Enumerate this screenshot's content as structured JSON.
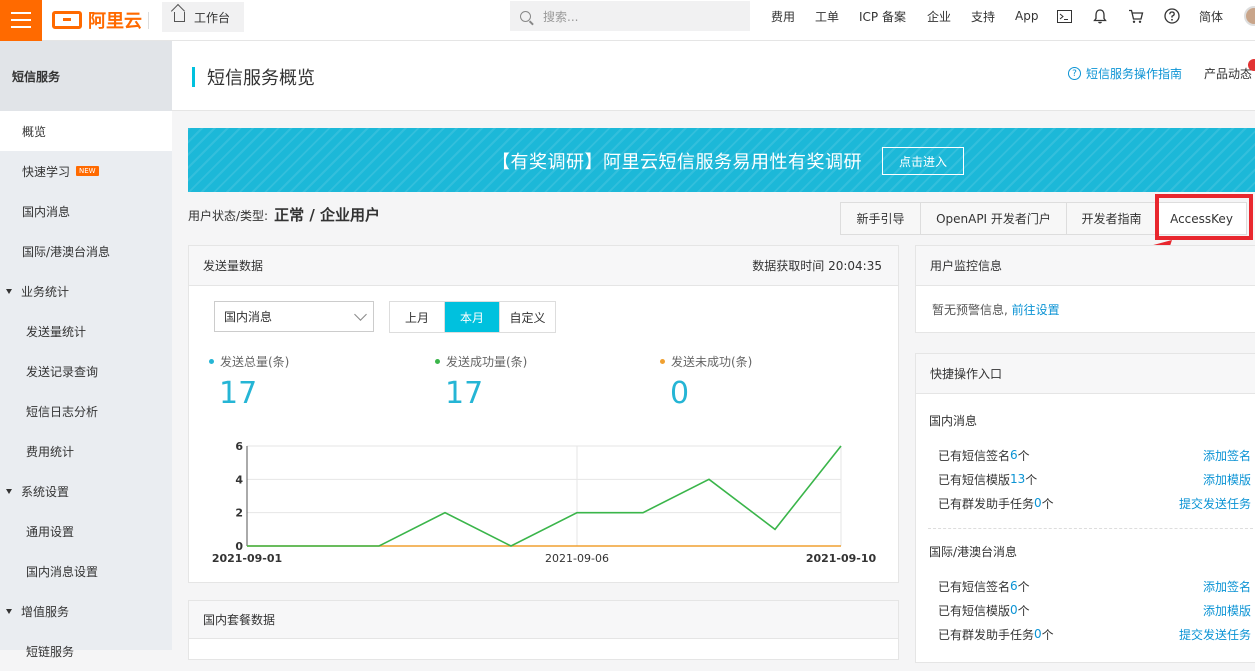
{
  "topbar": {
    "logo_text": "阿里云",
    "workbench_label": "工作台",
    "search_placeholder": "搜索...",
    "nav": [
      "费用",
      "工单",
      "ICP 备案",
      "企业",
      "支持",
      "App"
    ],
    "language": "简体",
    "icons": [
      "terminal-icon",
      "bell-icon",
      "cart-icon",
      "help-icon"
    ],
    "accent": "#ff6a00"
  },
  "sidebar": {
    "title": "短信服务",
    "items": [
      {
        "label": "概览",
        "type": "item",
        "active": true
      },
      {
        "label": "快速学习",
        "type": "item",
        "badge": "NEW"
      },
      {
        "label": "国内消息",
        "type": "item"
      },
      {
        "label": "国际/港澳台消息",
        "type": "item"
      },
      {
        "label": "业务统计",
        "type": "group"
      },
      {
        "label": "发送量统计",
        "type": "sub"
      },
      {
        "label": "发送记录查询",
        "type": "sub"
      },
      {
        "label": "短信日志分析",
        "type": "sub"
      },
      {
        "label": "费用统计",
        "type": "sub"
      },
      {
        "label": "系统设置",
        "type": "group"
      },
      {
        "label": "通用设置",
        "type": "sub"
      },
      {
        "label": "国内消息设置",
        "type": "sub"
      },
      {
        "label": "增值服务",
        "type": "group"
      },
      {
        "label": "短链服务",
        "type": "sub"
      }
    ]
  },
  "header": {
    "title": "短信服务概览",
    "guide_link": "短信服务操作指南",
    "product_news": "产品动态"
  },
  "banner": {
    "text": "【有奖调研】阿里云短信服务易用性有奖调研",
    "button": "点击进入",
    "color": "#1cb8d8"
  },
  "user_status": {
    "label": "用户状态/类型:",
    "value": "正常 / 企业用户"
  },
  "tabs": [
    "新手引导",
    "OpenAPI 开发者门户",
    "开发者指南",
    "AccessKey"
  ],
  "send_panel": {
    "title": "发送量数据",
    "fetch_time": "数据获取时间 20:04:35",
    "select_value": "国内消息",
    "segments": [
      {
        "label": "上月",
        "on": false
      },
      {
        "label": "本月",
        "on": true
      },
      {
        "label": "自定义",
        "on": false
      }
    ],
    "stats": [
      {
        "label": "发送总量(条)",
        "value": "17",
        "color": "#25b5d5"
      },
      {
        "label": "发送成功量(条)",
        "value": "17",
        "color": "#3ab54a"
      },
      {
        "label": "发送未成功(条)",
        "value": "0",
        "color": "#f0a030"
      }
    ]
  },
  "chart_data": {
    "type": "line",
    "x": [
      "2021-09-01",
      "2021-09-02",
      "2021-09-03",
      "2021-09-04",
      "2021-09-05",
      "2021-09-06",
      "2021-09-07",
      "2021-09-08",
      "2021-09-09",
      "2021-09-10"
    ],
    "xtick_labels": [
      "2021-09-01",
      "2021-09-06",
      "2021-09-10"
    ],
    "yticks": [
      "0",
      "2",
      "4",
      "6"
    ],
    "ylim": [
      0,
      6
    ],
    "series": [
      {
        "values": [
          0,
          0,
          0,
          2,
          0,
          2,
          2,
          4,
          1,
          6
        ],
        "color": "#3ab54a"
      },
      {
        "values": [
          0,
          0,
          0,
          0,
          0,
          0,
          0,
          0,
          0,
          0
        ],
        "color": "#f0a030"
      }
    ],
    "grid": true
  },
  "package_panel": {
    "title": "国内套餐数据"
  },
  "monitor_panel": {
    "title": "用户监控信息",
    "text": "暂无预警信息,",
    "link": "前往设置"
  },
  "quick_panel": {
    "title": "快捷操作入口",
    "sections": [
      {
        "title": "国内消息",
        "rows": [
          {
            "pre": "已有短信签名",
            "num": "6",
            "post": "个",
            "action": "添加签名"
          },
          {
            "pre": "已有短信模版",
            "num": "13",
            "post": "个",
            "action": "添加模版"
          },
          {
            "pre": "已有群发助手任务",
            "num": "0",
            "post": "个",
            "action": "提交发送任务"
          }
        ]
      },
      {
        "title": "国际/港澳台消息",
        "rows": [
          {
            "pre": "已有短信签名",
            "num": "6",
            "post": "个",
            "action": "添加签名"
          },
          {
            "pre": "已有短信模版",
            "num": "0",
            "post": "个",
            "action": "添加模版"
          },
          {
            "pre": "已有群发助手任务",
            "num": "0",
            "post": "个",
            "action": "提交发送任务"
          }
        ]
      }
    ]
  },
  "annotation_color": "#e8272e"
}
